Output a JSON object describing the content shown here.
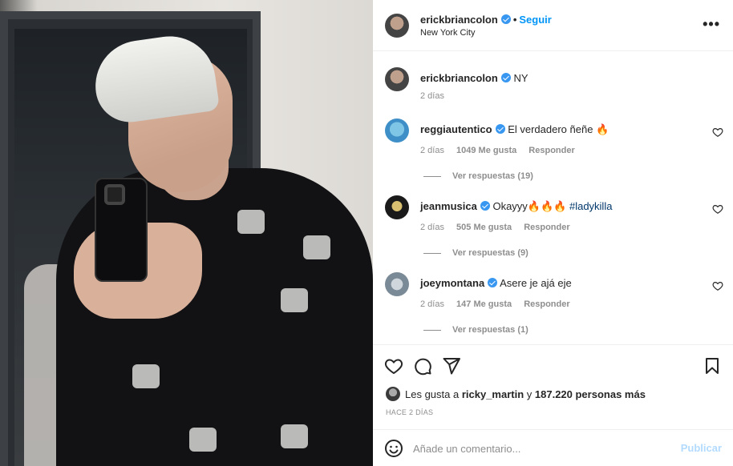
{
  "post": {
    "author": "erickbriancolon",
    "location": "New York City",
    "follow_label": "Seguir",
    "more_icon": "more-horizontal-icon",
    "separator": "•"
  },
  "caption": {
    "username": "erickbriancolon",
    "text": "NY",
    "time": "2 días"
  },
  "comments": [
    {
      "username": "reggiautentico",
      "text": "El verdadero ñeñe 🔥",
      "hashtag": "",
      "time": "2 días",
      "likes": "1049 Me gusta",
      "reply_label": "Responder",
      "replies": "Ver respuestas (19)"
    },
    {
      "username": "jeanmusica",
      "text": "Okayyy🔥🔥🔥 ",
      "hashtag": "#ladykilla",
      "time": "2 días",
      "likes": "505 Me gusta",
      "reply_label": "Responder",
      "replies": "Ver respuestas (9)"
    },
    {
      "username": "joeymontana",
      "text": "Asere je ajá eje",
      "hashtag": "",
      "time": "2 días",
      "likes": "147 Me gusta",
      "reply_label": "Responder",
      "replies": "Ver respuestas (1)"
    }
  ],
  "likes": {
    "prefix": "Les gusta a ",
    "user": "ricky_martin",
    "middle": " y ",
    "count": "187.220 personas más"
  },
  "posted_ago": "HACE 2 DÍAS",
  "add_comment": {
    "placeholder": "Añade un comentario...",
    "publish_label": "Publicar"
  },
  "colors": {
    "accent": "#0095f6",
    "verified": "#3897f0",
    "muted": "#8e8e8e",
    "publish_disabled": "#b3dbff"
  }
}
